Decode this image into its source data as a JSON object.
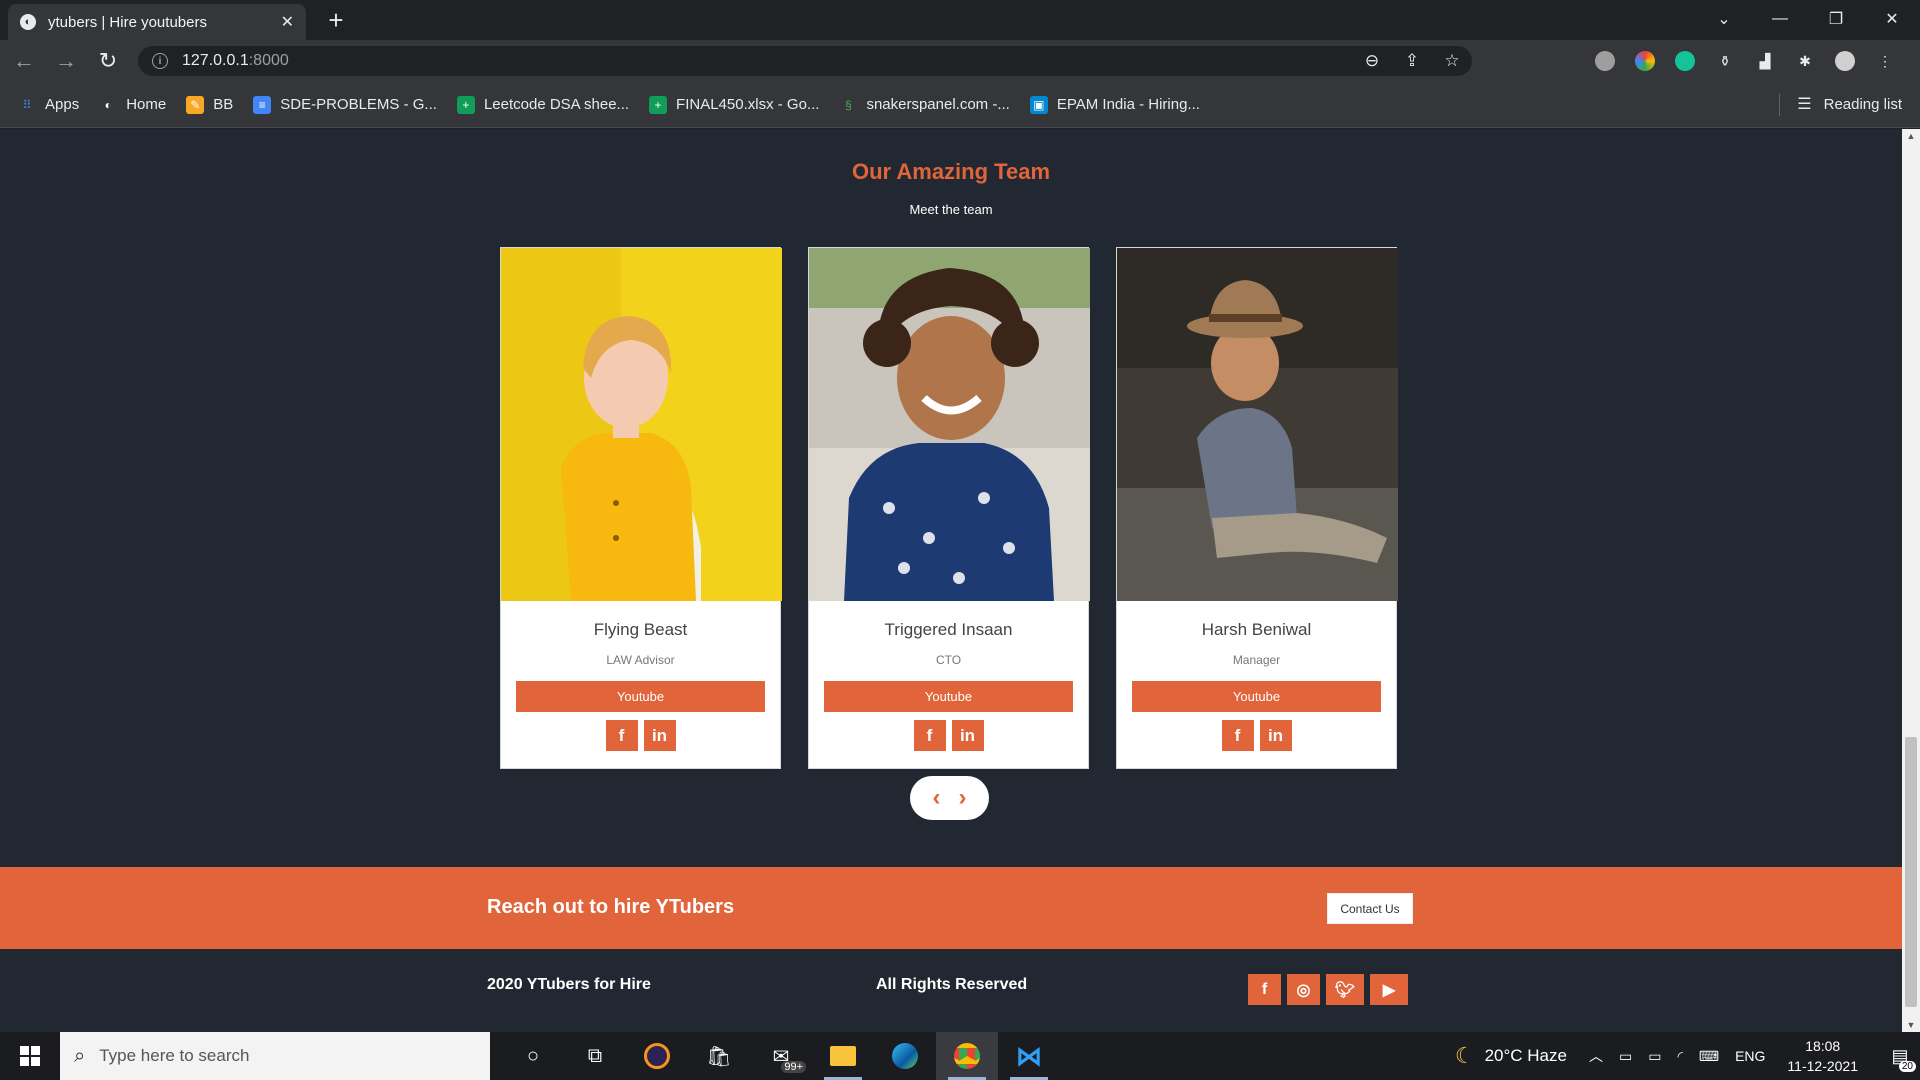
{
  "browser": {
    "tab_title": "ytubers | Hire youtubers",
    "url_host": "127.0.0.1",
    "url_port": ":8000",
    "bookmarks": [
      {
        "label": "Apps",
        "color": "#4285f4",
        "glyph": "⠿"
      },
      {
        "label": "Home",
        "color": "#5f6368",
        "glyph": "◐"
      },
      {
        "label": "BB",
        "color": "#f9a825",
        "glyph": "✎"
      },
      {
        "label": "SDE-PROBLEMS - G...",
        "color": "#4285f4",
        "glyph": "≡"
      },
      {
        "label": "Leetcode DSA shee...",
        "color": "#0f9d58",
        "glyph": "+"
      },
      {
        "label": "FINAL450.xlsx - Go...",
        "color": "#0f9d58",
        "glyph": "+"
      },
      {
        "label": "snakerspanel.com -...",
        "color": "#2e7d32",
        "glyph": "§"
      },
      {
        "label": "EPAM India - Hiring...",
        "color": "#0288d1",
        "glyph": "▣"
      }
    ],
    "reading_list": "Reading list"
  },
  "team": {
    "heading": "Our Amazing Team",
    "subheading": "Meet the team",
    "members": [
      {
        "name": "Flying Beast",
        "role": "LAW Advisor",
        "button": "Youtube"
      },
      {
        "name": "Triggered Insaan",
        "role": "CTO",
        "button": "Youtube"
      },
      {
        "name": "Harsh Beniwal",
        "role": "Manager",
        "button": "Youtube"
      }
    ],
    "prev": "‹",
    "next": "›"
  },
  "cta": {
    "text": "Reach out to hire YTubers",
    "button": "Contact Us"
  },
  "footer": {
    "copyright": "2020 YTubers for Hire",
    "rights": "All Rights Reserved"
  },
  "taskbar": {
    "search_placeholder": "Type here to search",
    "mail_badge": "99+",
    "weather": "20°C  Haze",
    "language": "ENG",
    "time": "18:08",
    "date": "11-12-2021",
    "notifications": "20"
  },
  "colors": {
    "accent": "#e2643a",
    "page_bg": "#222831"
  }
}
